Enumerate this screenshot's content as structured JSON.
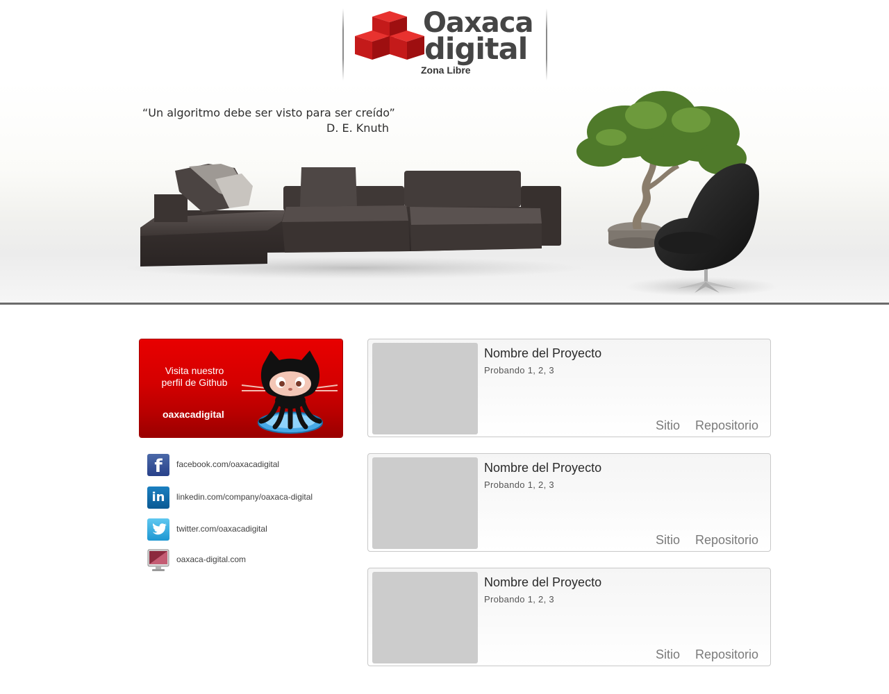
{
  "header": {
    "logo_line1": "Oaxaca",
    "logo_line2": "digital",
    "tagline": "Zona Libre"
  },
  "hero": {
    "quote": "“Un algoritmo debe ser visto para ser creído”",
    "author": "D. E. Knuth"
  },
  "github_card": {
    "line1": "Visita nuestro",
    "line2": "perfil de Github",
    "username": "oaxacadigital"
  },
  "social": [
    {
      "icon": "facebook-icon",
      "label": "facebook.com/oaxacadigital"
    },
    {
      "icon": "linkedin-icon",
      "label": "linkedin.com/company/oaxaca-digital"
    },
    {
      "icon": "twitter-icon",
      "label": "twitter.com/oaxacadigital"
    },
    {
      "icon": "monitor-icon",
      "label": "oaxaca-digital.com"
    }
  ],
  "projects": [
    {
      "title": "Nombre del Proyecto",
      "subtitle": "Probando 1, 2, 3",
      "site_label": "Sitio",
      "repo_label": "Repositorio"
    },
    {
      "title": "Nombre del Proyecto",
      "subtitle": "Probando 1, 2, 3",
      "site_label": "Sitio",
      "repo_label": "Repositorio"
    },
    {
      "title": "Nombre del Proyecto",
      "subtitle": "Probando 1, 2, 3",
      "site_label": "Sitio",
      "repo_label": "Repositorio"
    }
  ],
  "colors": {
    "brand_red": "#d40000",
    "logo_gray": "#454545",
    "card_border": "#c8c8c8",
    "thumb_gray": "#cccccc"
  }
}
